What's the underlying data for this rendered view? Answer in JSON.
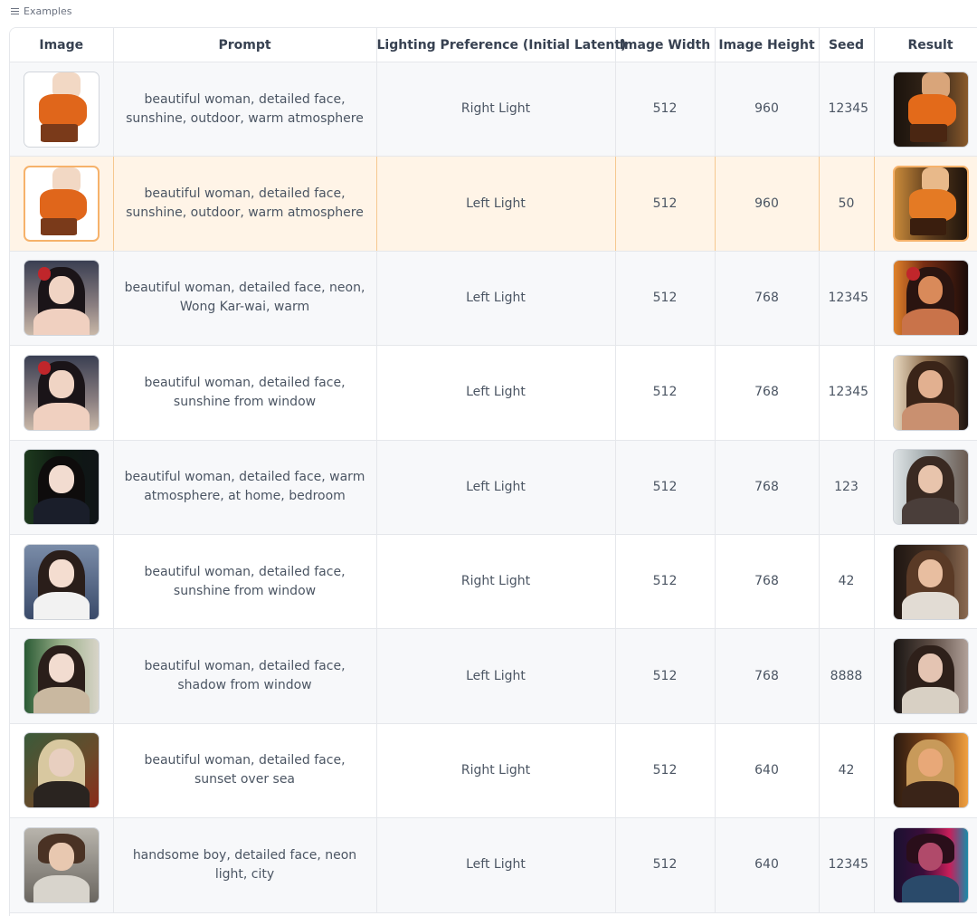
{
  "header": {
    "label": "Examples",
    "icon": "list-icon"
  },
  "table": {
    "columns": [
      "Image",
      "Prompt",
      "Lighting Preference (Initial Latent)",
      "Image Width",
      "Image Height",
      "Seed",
      "Result"
    ],
    "rows": [
      {
        "prompt": "beautiful woman, detailed face, sunshine, outdoor, warm atmosphere",
        "lighting": "Right Light",
        "width": "512",
        "height": "960",
        "seed": "12345"
      },
      {
        "prompt": "beautiful woman, detailed face, sunshine, outdoor, warm atmosphere",
        "lighting": "Left Light",
        "width": "512",
        "height": "960",
        "seed": "50"
      },
      {
        "prompt": "beautiful woman, detailed face, neon, Wong Kar-wai, warm",
        "lighting": "Left Light",
        "width": "512",
        "height": "768",
        "seed": "12345"
      },
      {
        "prompt": "beautiful woman, detailed face, sunshine from window",
        "lighting": "Left Light",
        "width": "512",
        "height": "768",
        "seed": "12345"
      },
      {
        "prompt": "beautiful woman, detailed face, warm atmosphere, at home, bedroom",
        "lighting": "Left Light",
        "width": "512",
        "height": "768",
        "seed": "123"
      },
      {
        "prompt": "beautiful woman, detailed face, sunshine from window",
        "lighting": "Right Light",
        "width": "512",
        "height": "768",
        "seed": "42"
      },
      {
        "prompt": "beautiful woman, detailed face, shadow from window",
        "lighting": "Left Light",
        "width": "512",
        "height": "768",
        "seed": "8888"
      },
      {
        "prompt": "beautiful woman, detailed face, sunset over sea",
        "lighting": "Right Light",
        "width": "512",
        "height": "640",
        "seed": "42"
      },
      {
        "prompt": "handsome boy, detailed face, neon light, city",
        "lighting": "Left Light",
        "width": "512",
        "height": "640",
        "seed": "12345"
      }
    ]
  },
  "colors": {
    "selected_row": "#fff4e7",
    "selected_border": "#f6b26b",
    "stripe": "#f7f8fa",
    "border": "#e5e7eb"
  }
}
